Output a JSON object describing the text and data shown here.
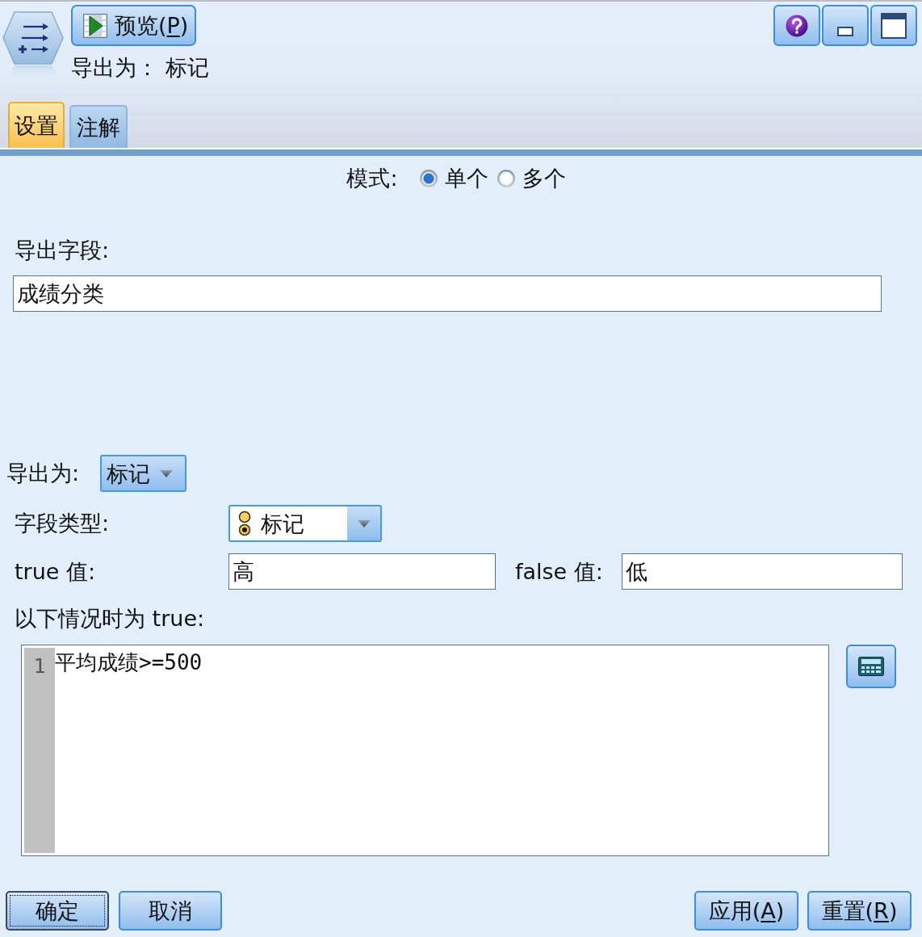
{
  "header": {
    "preview_button": {
      "label": "预览(",
      "mnemonic": "P",
      "label_end": ")"
    },
    "subtitle": "导出为： 标记"
  },
  "tabs": [
    {
      "label": "设置",
      "selected": true
    },
    {
      "label": "注解",
      "selected": false
    }
  ],
  "mode": {
    "label": "模式:",
    "options": [
      {
        "label": "单个",
        "selected": true
      },
      {
        "label": "多个",
        "selected": false
      }
    ]
  },
  "derive_field": {
    "label": "导出字段:",
    "value": "成绩分类"
  },
  "derive_as": {
    "label": "导出为:",
    "value": "标记"
  },
  "field_type": {
    "label": "字段类型:",
    "value": "标记"
  },
  "true_value": {
    "label": "true 值:",
    "value": "高"
  },
  "false_value": {
    "label": "false 值:",
    "value": "低"
  },
  "condition": {
    "label": "以下情况时为 true:",
    "lines": [
      {
        "number": "1",
        "code": "平均成绩>=500"
      }
    ]
  },
  "buttons_left": [
    {
      "label": "确定",
      "focused": true
    },
    {
      "label": "取消",
      "focused": false
    }
  ],
  "buttons_right": [
    {
      "label": "应用(",
      "mnemonic": "A",
      "label_end": ")",
      "focused": false
    },
    {
      "label": "重置(",
      "mnemonic": "R",
      "label_end": ")",
      "focused": false
    }
  ]
}
